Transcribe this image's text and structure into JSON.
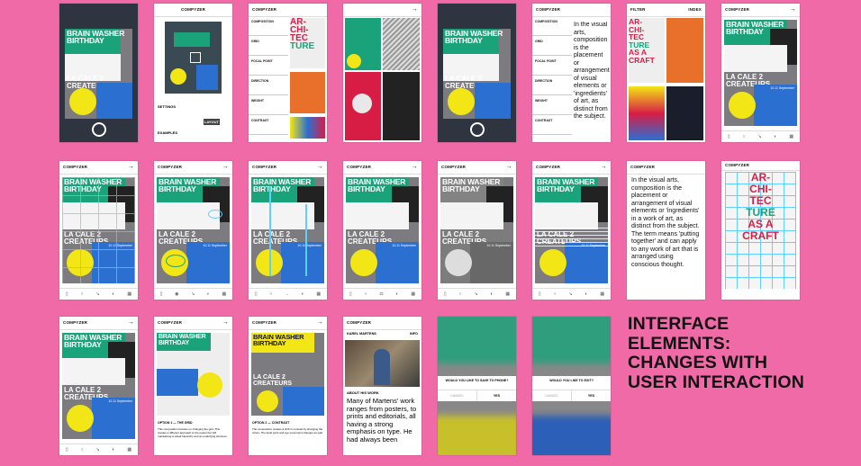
{
  "app": {
    "name": "COMPYZER"
  },
  "poster": {
    "title1": "BRAIN WASHER",
    "title2": "BIRTHDAY",
    "num": "(6°)",
    "title3": "LA CALE 2",
    "title4": "CREATEURS",
    "date": "10.11 September"
  },
  "menu": {
    "items": [
      "COMPOSITION",
      "GRID",
      "FOCAL POINT",
      "DIRECTION",
      "WEIGHT",
      "CONTRAST",
      "RHYTHM"
    ]
  },
  "settings": {
    "settings_label": "SETTINGS",
    "layout_label": "LAYOUT",
    "examples_label": "EXAMPLES"
  },
  "filter": {
    "label": "FILTER",
    "right": "INDEX"
  },
  "arch": {
    "words": [
      "AR-",
      "CHI-",
      "TEC",
      "TURE",
      "AS A",
      "CRAFT"
    ]
  },
  "desc": {
    "short": "In the visual arts, composition is the placement or arrangement of visual elements or 'ingredients' of art, as distinct from the subject.",
    "long": "In the visual arts, composition is the placement or arrangement of visual elements or 'ingredients' in a work of art, as distinct from the subject. The term means 'putting together' and can apply to any work of art that is arranged using conscious thought."
  },
  "options": {
    "grid_title": "OPTION 1 — THE GRID",
    "grid_body": "This composition focuses on changing the grid. This creates a different approach to the poster but still maintaining a visual hierarchy and an underlying structure.",
    "contrast_title": "OPTION 2 — CONTRAST",
    "contrast_body": "The composition creates a shift in contrast by changing the colors. The focal point and eye movement changes as well."
  },
  "profile": {
    "name": "KAREL MARTENS",
    "info": "INFO",
    "about": "ABOUT HIS WORK",
    "body": "Many of Martens' work ranges from posters, to prints and editorials, all having a strong emphasis on type. He had always been"
  },
  "dialogs": {
    "save_q": "WOULD YOU LIKE TO SAVE TO PHONE?",
    "edit_q": "WOULD YOU LIKE TO EXIT?",
    "cancel": "CANCEL",
    "yes": "YES"
  },
  "heading": {
    "line1": "INTERFACE",
    "line2": "ELEMENTS:",
    "line3": "CHANGES WITH",
    "line4": "USER INTERACTION"
  },
  "colors": {
    "background": "#ef6aa6",
    "green": "#1aa37a",
    "blue": "#2b6fd1",
    "yellow": "#f3e616"
  }
}
